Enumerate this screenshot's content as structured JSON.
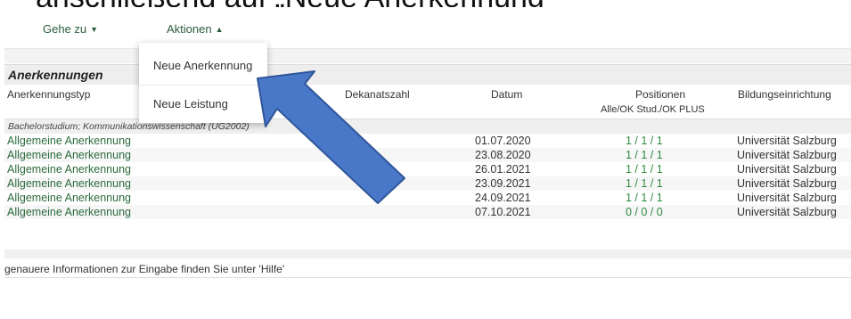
{
  "slide": {
    "title": "anschließend auf „Neue Anerkennung"
  },
  "nav": {
    "goto_label": "Gehe zu",
    "actions_label": "Aktionen"
  },
  "dropdown": {
    "item1": "Neue Anerkennung",
    "item2": "Neue Leistung"
  },
  "section": {
    "title": "Anerkennungen"
  },
  "headers": {
    "type": "Anerkennungstyp",
    "dekanatszahl": "Dekanatszahl",
    "datum": "Datum",
    "positionen": "Positionen",
    "positionen_sub": "Alle/OK Stud./OK PLUS",
    "bildung": "Bildungseinrichtung"
  },
  "program": "Bachelorstudium; Kommunikationswissenschaft (UG2002)",
  "rows": [
    {
      "type": "Allgemeine Anerkennung",
      "date": "01.07.2020",
      "pos": "1 / 1 / 1",
      "edu": "Universität Salzburg"
    },
    {
      "type": "Allgemeine Anerkennung",
      "date": "23.08.2020",
      "pos": "1 / 1 / 1",
      "edu": "Universität Salzburg"
    },
    {
      "type": "Allgemeine Anerkennung",
      "date": "26.01.2021",
      "pos": "1 / 1 / 1",
      "edu": "Universität Salzburg"
    },
    {
      "type": "Allgemeine Anerkennung",
      "date": "23.09.2021",
      "pos": "1 / 1 / 1",
      "edu": "Universität Salzburg"
    },
    {
      "type": "Allgemeine Anerkennung",
      "date": "24.09.2021",
      "pos": "1 / 1 / 1",
      "edu": "Universität Salzburg"
    },
    {
      "type": "Allgemeine Anerkennung",
      "date": "07.10.2021",
      "pos": "0 / 0 / 0",
      "edu": "Universität Salzburg"
    }
  ],
  "footer": {
    "info": "genauere Informationen zur Eingabe finden Sie unter 'Hilfe'"
  },
  "colors": {
    "arrow_fill": "#4a78c8",
    "arrow_stroke": "#2f559a",
    "link_green": "#2c6b3c"
  }
}
